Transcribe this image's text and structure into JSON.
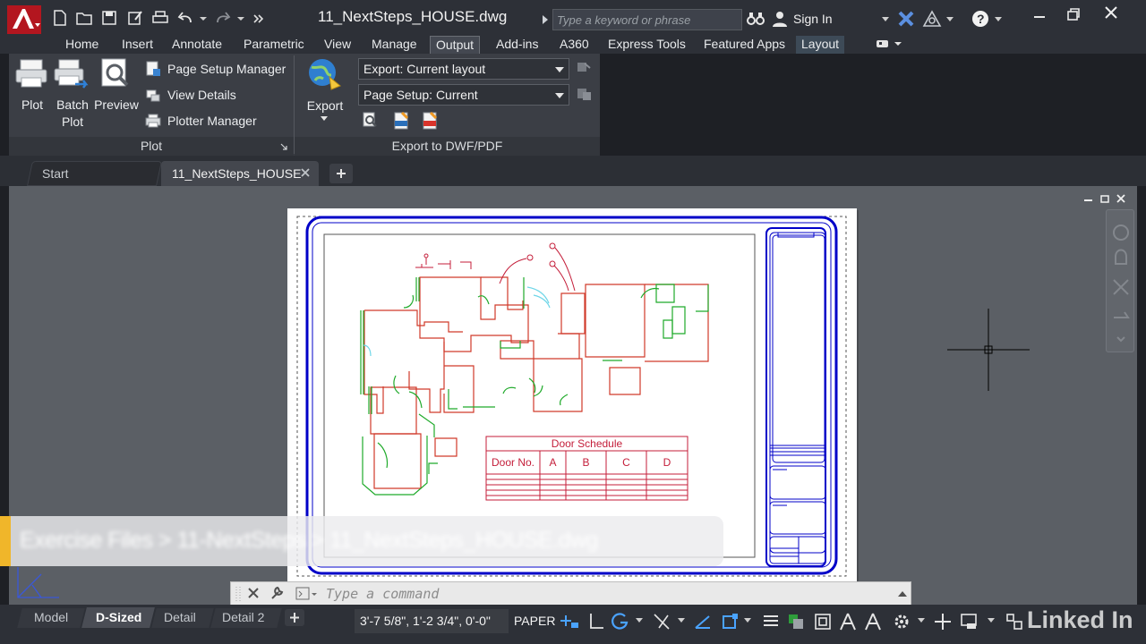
{
  "app": {
    "title": "11_NextSteps_HOUSE.dwg",
    "search_placeholder": "Type a keyword or phrase",
    "sign_in": "Sign In"
  },
  "ribbon_tabs": [
    {
      "label": "Home"
    },
    {
      "label": "Insert"
    },
    {
      "label": "Annotate"
    },
    {
      "label": "Parametric"
    },
    {
      "label": "View"
    },
    {
      "label": "Manage"
    },
    {
      "label": "Output",
      "active": true
    },
    {
      "label": "Add-ins"
    },
    {
      "label": "A360"
    },
    {
      "label": "Express Tools"
    },
    {
      "label": "Featured Apps"
    },
    {
      "label": "Layout"
    }
  ],
  "plot_panel": {
    "title": "Plot",
    "plot": "Plot",
    "batch_plot_1": "Batch",
    "batch_plot_2": "Plot",
    "preview": "Preview",
    "page_setup_manager": "Page Setup Manager",
    "view_details": "View Details",
    "plotter_manager": "Plotter Manager"
  },
  "export_panel": {
    "title": "Export to DWF/PDF",
    "export": "Export",
    "export_dropdown": "Export: Current layout",
    "page_setup_dropdown": "Page Setup: Current"
  },
  "file_tabs": [
    {
      "label": "Start"
    },
    {
      "label": "11_NextSteps_HOUSE",
      "active": true
    }
  ],
  "drawing": {
    "door_schedule_title": "Door Schedule",
    "door_schedule_headers": [
      "Door No.",
      "A",
      "B",
      "C",
      "D"
    ]
  },
  "command_line": {
    "placeholder": "Type a command"
  },
  "layout_tabs": [
    {
      "label": "Model"
    },
    {
      "label": "D-Sized",
      "active": true
    },
    {
      "label": "Detail"
    },
    {
      "label": "Detail 2"
    }
  ],
  "status": {
    "coordinates": "3'-7 5/8\", 1'-2 3/4\", 0'-0\"",
    "space": "PAPER"
  },
  "overlay": {
    "path": "Exercise Files > 11-NextSteps > 11_NextSteps_HOUSE.dwg",
    "watermark": "Linked In"
  },
  "colors": {
    "app_red": "#c8102e",
    "border_blue": "#0000c8",
    "wall_red": "#d03a2a",
    "door_green": "#1faa2a",
    "schedule_red": "#c41e3a",
    "banner_accent": "#f0b62a"
  }
}
